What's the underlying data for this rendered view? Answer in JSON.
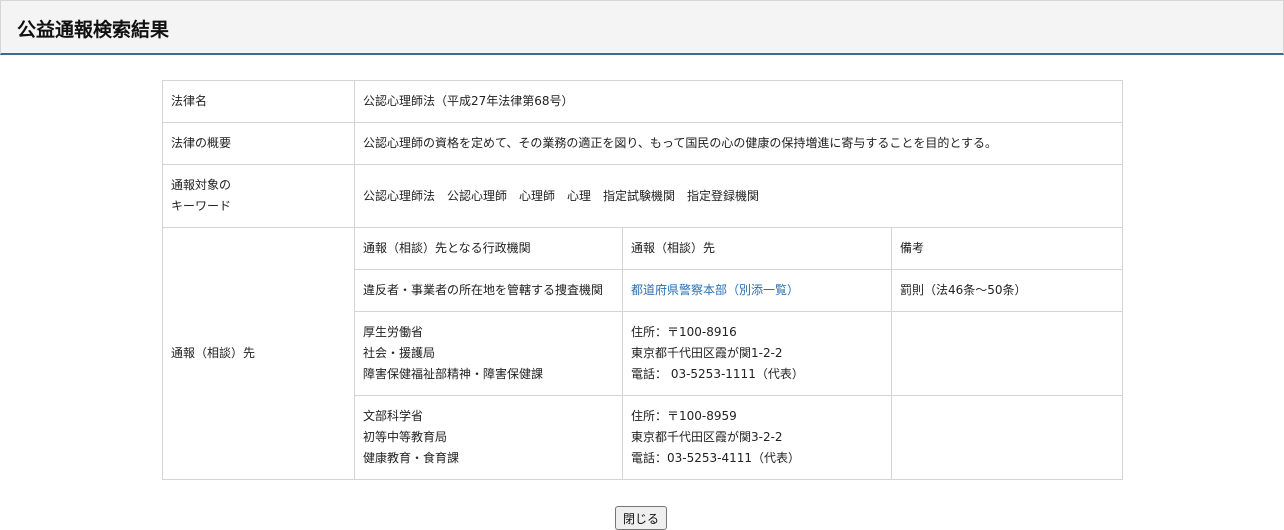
{
  "page": {
    "title": "公益通報検索結果",
    "close_label": "閉じる"
  },
  "details": {
    "law_name_label": "法律名",
    "law_name_value": "公認心理師法（平成27年法律第68号）",
    "summary_label": "法律の概要",
    "summary_value": "公認心理師の資格を定めて、その業務の適正を図り、もって国民の心の健康の保持増進に寄与することを目的とする。",
    "keywords_label_line1": "通報対象の",
    "keywords_label_line2": "キーワード",
    "keywords_value": "公認心理師法　公認心理師　心理師　心理　指定試験機関　指定登録機関",
    "contacts_label": "通報（相談）先"
  },
  "contacts": {
    "headers": {
      "agency": "通報（相談）先となる行政機関",
      "destination": "通報（相談）先",
      "remarks": "備考"
    },
    "rows": [
      {
        "agency_lines": [
          "違反者・事業者の所在地を管轄する捜査機関"
        ],
        "destination_link": "都道府県警察本部（別添一覧）",
        "remarks": "罰則（法46条～50条）"
      },
      {
        "agency_lines": [
          "厚生労働省",
          "社会・援護局",
          "障害保健福祉部精神・障害保健課"
        ],
        "destination_lines": [
          "住所：〒100-8916",
          "東京都千代田区霞が関1-2-2",
          "電話： 03-5253-1111（代表）"
        ],
        "remarks": ""
      },
      {
        "agency_lines": [
          "文部科学省",
          "初等中等教育局",
          "健康教育・食育課"
        ],
        "destination_lines": [
          "住所：〒100-8959",
          "東京都千代田区霞が関3-2-2",
          "電話：03-5253-4111（代表）"
        ],
        "remarks": ""
      }
    ]
  }
}
